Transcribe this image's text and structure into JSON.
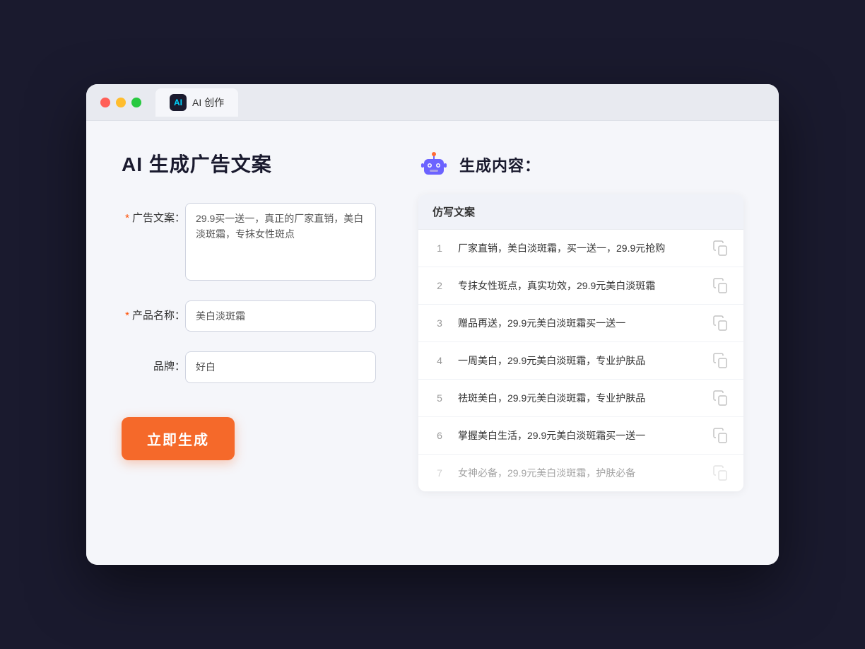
{
  "window": {
    "tab_label": "AI 创作"
  },
  "page": {
    "title": "AI 生成广告文案"
  },
  "form": {
    "ad_copy_label": "广告文案：",
    "ad_copy_required": "*",
    "ad_copy_value": "29.9买一送一，真正的厂家直销，美白淡斑霜，专抹女性斑点",
    "product_name_label": "产品名称：",
    "product_name_required": "*",
    "product_name_value": "美白淡斑霜",
    "brand_label": "品牌：",
    "brand_value": "好白",
    "generate_button": "立即生成"
  },
  "result": {
    "header": "生成内容：",
    "column_header": "仿写文案",
    "items": [
      {
        "number": 1,
        "text": "厂家直销，美白淡斑霜，买一送一，29.9元抢购",
        "faded": false
      },
      {
        "number": 2,
        "text": "专抹女性斑点，真实功效，29.9元美白淡斑霜",
        "faded": false
      },
      {
        "number": 3,
        "text": "赠品再送，29.9元美白淡斑霜买一送一",
        "faded": false
      },
      {
        "number": 4,
        "text": "一周美白，29.9元美白淡斑霜，专业护肤品",
        "faded": false
      },
      {
        "number": 5,
        "text": "祛斑美白，29.9元美白淡斑霜，专业护肤品",
        "faded": false
      },
      {
        "number": 6,
        "text": "掌握美白生活，29.9元美白淡斑霜买一送一",
        "faded": false
      },
      {
        "number": 7,
        "text": "女神必备，29.9元美白淡斑霜，护肤必备",
        "faded": true
      }
    ]
  }
}
